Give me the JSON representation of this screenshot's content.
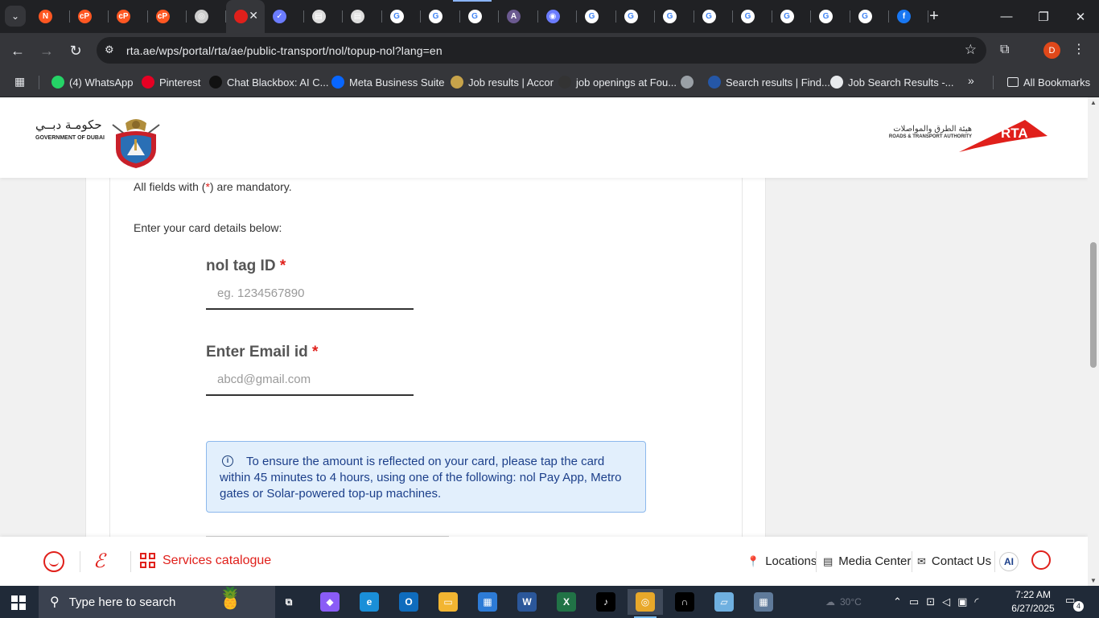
{
  "browser": {
    "tabs": [
      {
        "icon": "pdf-icon",
        "color": "#ff5722",
        "letter": "N"
      },
      {
        "icon": "cp-icon",
        "color": "#ff5722",
        "letter": "cP"
      },
      {
        "icon": "cp-icon",
        "color": "#ff5722",
        "letter": "cP"
      },
      {
        "icon": "cp-icon",
        "color": "#ff5722",
        "letter": "cP"
      },
      {
        "icon": "chatgpt-icon",
        "color": "#cccccc",
        "letter": "◎"
      },
      {
        "icon": "rta-tab-icon",
        "color": "#e0201b",
        "letter": ""
      },
      {
        "icon": "brand-icon",
        "color": "#6b7cff",
        "letter": "✓"
      },
      {
        "icon": "doc-icon",
        "color": "#dddddd",
        "letter": "▤"
      },
      {
        "icon": "doc-icon",
        "color": "#dddddd",
        "letter": "▤"
      },
      {
        "icon": "google-icon",
        "color": "#ffffff",
        "letter": "G"
      },
      {
        "icon": "google-icon",
        "color": "#ffffff",
        "letter": "G"
      },
      {
        "icon": "google-icon",
        "color": "#ffffff",
        "letter": "G"
      },
      {
        "icon": "kick-icon",
        "color": "#6b5a90",
        "letter": "A"
      },
      {
        "icon": "circle-icon",
        "color": "#6b7cff",
        "letter": "◉"
      },
      {
        "icon": "google-icon",
        "color": "#ffffff",
        "letter": "G"
      },
      {
        "icon": "google-icon",
        "color": "#ffffff",
        "letter": "G"
      },
      {
        "icon": "google-icon",
        "color": "#ffffff",
        "letter": "G"
      },
      {
        "icon": "google-icon",
        "color": "#ffffff",
        "letter": "G"
      },
      {
        "icon": "google-icon",
        "color": "#ffffff",
        "letter": "G"
      },
      {
        "icon": "google-icon",
        "color": "#ffffff",
        "letter": "G"
      },
      {
        "icon": "google-icon",
        "color": "#ffffff",
        "letter": "G"
      },
      {
        "icon": "google-icon",
        "color": "#ffffff",
        "letter": "G"
      },
      {
        "icon": "facebook-icon",
        "color": "#1877f2",
        "letter": "f"
      }
    ],
    "url": "rta.ae/wps/portal/rta/ae/public-transport/nol/topup-nol?lang=en",
    "profile_initial": "D",
    "bookmarks": [
      {
        "label": "(4) WhatsApp",
        "color": "#25d366"
      },
      {
        "label": "Pinterest",
        "color": "#e60023"
      },
      {
        "label": "Chat Blackbox: AI C...",
        "color": "#111111"
      },
      {
        "label": "Meta Business Suite",
        "color": "#0866ff"
      },
      {
        "label": "Job results | Accor",
        "color": "#c7a34a"
      },
      {
        "label": "job openings at Fou...",
        "color": "#333333"
      },
      {
        "label": "",
        "color": "#9aa0a6"
      },
      {
        "label": "Search results | Find...",
        "color": "#2557a7"
      },
      {
        "label": "Job Search Results -...",
        "color": "#e8eaed"
      }
    ],
    "all_bookmarks": "All Bookmarks"
  },
  "header": {
    "gov_arabic": "حكومـة دبــي",
    "gov_english": "GOVERNMENT OF DUBAI",
    "rta_arabic": "هيئة الطرق والمواصلات",
    "rta_english": "ROADS & TRANSPORT AUTHORITY",
    "rta_logo_text": "RTA"
  },
  "form": {
    "mandatory_note_prefix": "All fields with (",
    "mandatory_star": "*",
    "mandatory_note_suffix": ") are mandatory.",
    "intro": "Enter your card details below:",
    "nol_label": "nol tag ID",
    "nol_placeholder": "eg. 1234567890",
    "email_label": "Enter Email id",
    "email_placeholder": "abcd@gmail.com",
    "required_mark": "*",
    "info_text": "To ensure the amount is reflected on your card, please tap the card within 45 minutes to 4 hours, using one of the following: nol Pay App, Metro gates or Solar-powered top-up machines."
  },
  "footer": {
    "services": "Services catalogue",
    "locations": "Locations",
    "media": "Media Center",
    "contact": "Contact Us",
    "ai": "AI"
  },
  "taskbar": {
    "search_placeholder": "Type here to search",
    "weather": "30°C",
    "time": "7:22 AM",
    "date": "6/27/2025",
    "notifications": "4"
  }
}
